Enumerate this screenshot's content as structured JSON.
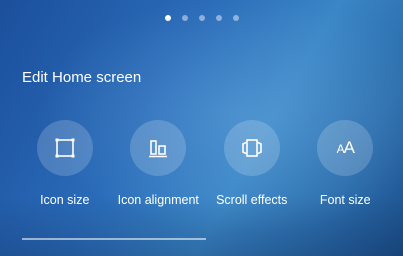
{
  "page_indicator": {
    "count": 5,
    "active_index": 0
  },
  "panel": {
    "title": "Edit Home screen",
    "options": [
      {
        "label": "Icon size",
        "icon": "icon-size-icon"
      },
      {
        "label": "Icon alignment",
        "icon": "icon-alignment-icon"
      },
      {
        "label": "Scroll effects",
        "icon": "scroll-effects-icon"
      },
      {
        "label": "Font size",
        "icon": "font-size-icon"
      }
    ],
    "font_size_glyph": "AA"
  }
}
